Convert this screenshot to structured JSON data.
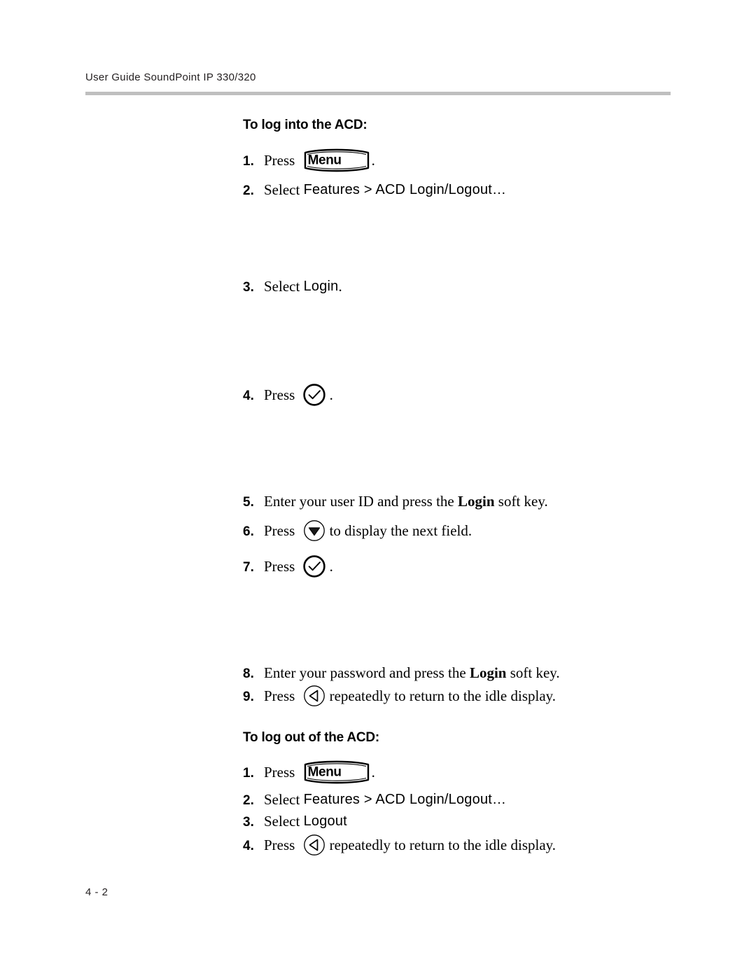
{
  "header": {
    "running_head": "User Guide SoundPoint IP 330/320",
    "rule_color": "#bfbfbf"
  },
  "footer": {
    "folio": "4 - 2"
  },
  "sections": [
    {
      "heading": "To log into the ACD:",
      "steps": [
        {
          "num": "1.",
          "pre": "Press ",
          "key": "menu",
          "key_label": "Menu",
          "post": "."
        },
        {
          "num": "2.",
          "pre": "Select ",
          "screen": "Features > ACD Login/Logout…",
          "post": ""
        },
        {
          "num": "3.",
          "pre": "Select ",
          "screen": "Login",
          "post": "."
        },
        {
          "num": "4.",
          "pre": "Press ",
          "key": "select-check",
          "post": "."
        },
        {
          "num": "5.",
          "pre": "Enter your user ID and press the ",
          "bold": "Login",
          "post": " soft key."
        },
        {
          "num": "6.",
          "pre": "Press ",
          "key": "arrow-down",
          "post": "to display the next field."
        },
        {
          "num": "7.",
          "pre": "Press ",
          "key": "select-check",
          "post": "."
        },
        {
          "num": "8.",
          "pre": "Enter your password and press the ",
          "bold": "Login",
          "post": " soft key."
        },
        {
          "num": "9.",
          "pre": "Press ",
          "key": "arrow-left",
          "post": "repeatedly to return to the idle display."
        }
      ]
    },
    {
      "heading": "To log out of the ACD:",
      "steps": [
        {
          "num": "1.",
          "pre": "Press ",
          "key": "menu",
          "key_label": "Menu",
          "post": "."
        },
        {
          "num": "2.",
          "pre": "Select ",
          "screen": "Features > ACD Login/Logout…",
          "post": ""
        },
        {
          "num": "3.",
          "pre": "Select ",
          "screen": "Logout",
          "post": ""
        },
        {
          "num": "4.",
          "pre": "Press ",
          "key": "arrow-left",
          "post": "repeatedly to return to the idle display."
        }
      ]
    }
  ],
  "icons": {
    "menu_key": "menu-hard-key-icon",
    "select_check": "select-checkmark-key-icon",
    "arrow_down": "down-arrow-key-icon",
    "arrow_left": "left-arrow-key-icon"
  },
  "layout": {
    "step_tops_section1": [
      212,
      256,
      394,
      547,
      701,
      741,
      792,
      946,
      977
    ],
    "heading_tops": [
      168,
      1043
    ],
    "step_tops_section2": [
      1086,
      1127,
      1158,
      1190
    ]
  }
}
